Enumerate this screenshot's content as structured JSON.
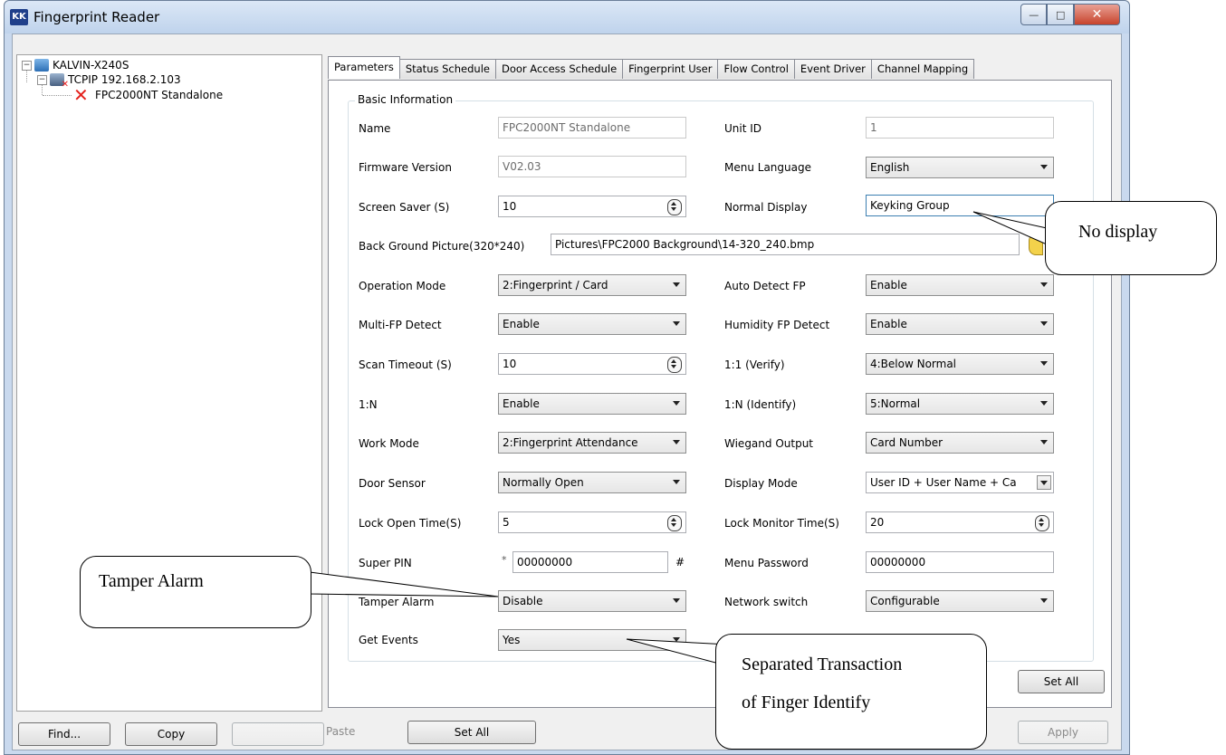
{
  "window": {
    "title": "Fingerprint Reader",
    "icon_text": "KK",
    "min": "—",
    "max": "□",
    "close": "✕"
  },
  "tree": {
    "root": "KALVIN-X240S",
    "connection": "TCPIP 192.168.2.103",
    "device": "FPC2000NT Standalone"
  },
  "tabs": [
    "Parameters",
    "Status Schedule",
    "Door Access Schedule",
    "Fingerprint User",
    "Flow Control",
    "Event Driver",
    "Channel Mapping"
  ],
  "group_title": "Basic Information",
  "fields": {
    "name": {
      "label": "Name",
      "value": "FPC2000NT Standalone"
    },
    "unit_id": {
      "label": "Unit ID",
      "value": "1"
    },
    "firmware": {
      "label": "Firmware Version",
      "value": "V02.03"
    },
    "menu_language": {
      "label": "Menu Language",
      "value": "English"
    },
    "screen_saver": {
      "label": "Screen Saver (S)",
      "value": "10"
    },
    "normal_display": {
      "label": "Normal Display",
      "value": "Keyking Group"
    },
    "background": {
      "label": "Back Ground Picture(320*240)",
      "value": "Pictures\\FPC2000 Background\\14-320_240.bmp"
    },
    "operation_mode": {
      "label": "Operation Mode",
      "value": "2:Fingerprint / Card"
    },
    "auto_detect": {
      "label": "Auto Detect FP",
      "value": "Enable"
    },
    "multi_fp": {
      "label": "Multi-FP Detect",
      "value": "Enable"
    },
    "humidity": {
      "label": "Humidity FP Detect",
      "value": "Enable"
    },
    "scan_timeout": {
      "label": "Scan Timeout (S)",
      "value": "10"
    },
    "verify": {
      "label": "1:1 (Verify)",
      "value": "4:Below Normal"
    },
    "one_n": {
      "label": "1:N",
      "value": "Enable"
    },
    "identify": {
      "label": "1:N (Identify)",
      "value": "5:Normal"
    },
    "work_mode": {
      "label": "Work Mode",
      "value": "2:Fingerprint Attendance"
    },
    "wiegand": {
      "label": "Wiegand Output",
      "value": "Card Number"
    },
    "door_sensor": {
      "label": "Door Sensor",
      "value": "Normally Open"
    },
    "display_mode": {
      "label": "Display Mode",
      "value": "User ID + User Name + Ca"
    },
    "lock_open": {
      "label": "Lock Open Time(S)",
      "value": "5"
    },
    "lock_monitor": {
      "label": "Lock Monitor Time(S)",
      "value": "20"
    },
    "super_pin": {
      "label": "Super PIN",
      "prefix": "*",
      "value": "00000000",
      "suffix": "#"
    },
    "menu_password": {
      "label": "Menu Password",
      "value": "00000000"
    },
    "tamper": {
      "label": "Tamper Alarm",
      "value": "Disable"
    },
    "network": {
      "label": "Network switch",
      "value": "Configurable"
    },
    "get_events": {
      "label": "Get Events",
      "value": "Yes"
    }
  },
  "buttons": {
    "set_all_tab": "Set All",
    "find": "Find...",
    "copy": "Copy",
    "paste": "Paste",
    "set_all": "Set All",
    "apply": "Apply"
  },
  "callouts": {
    "no_display": "No display",
    "tamper": "Tamper Alarm",
    "separated_line1": "Separated Transaction",
    "separated_line2": "of Finger Identify"
  }
}
